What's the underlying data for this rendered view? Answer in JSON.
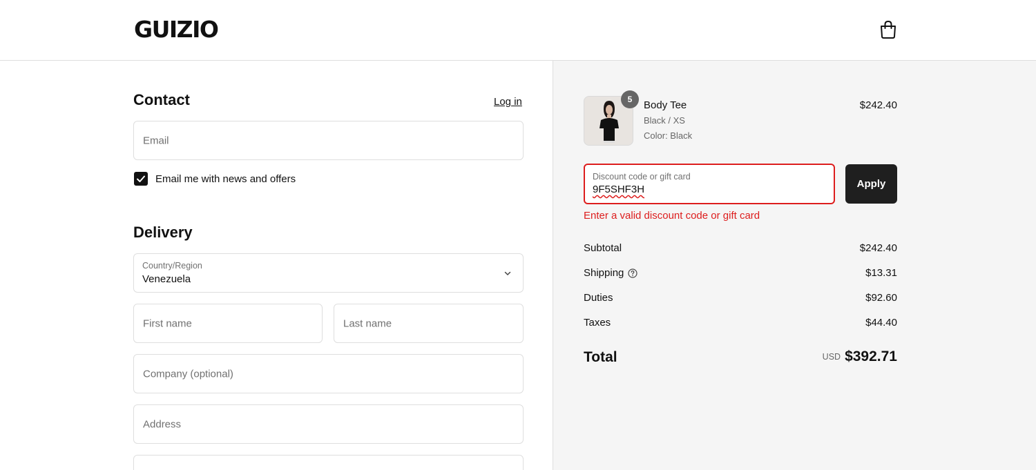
{
  "brand": {
    "logo_text": "GUIZIO"
  },
  "contact": {
    "heading": "Contact",
    "login_link": "Log in",
    "email_placeholder": "Email",
    "newsletter_label": "Email me with news and offers",
    "newsletter_checked": true
  },
  "delivery": {
    "heading": "Delivery",
    "country_label": "Country/Region",
    "country_value": "Venezuela",
    "first_name_placeholder": "First name",
    "last_name_placeholder": "Last name",
    "company_placeholder": "Company (optional)",
    "address_placeholder": "Address"
  },
  "order": {
    "item": {
      "name": "Body Tee",
      "variant": "Black / XS",
      "color": "Color: Black",
      "price": "$242.40",
      "quantity": "5"
    },
    "discount": {
      "label": "Discount code or gift card",
      "value": "9F5SHF3H",
      "apply_label": "Apply",
      "error": "Enter a valid discount code or gift card"
    },
    "summary": {
      "subtotal_label": "Subtotal",
      "subtotal_value": "$242.40",
      "shipping_label": "Shipping",
      "shipping_value": "$13.31",
      "duties_label": "Duties",
      "duties_value": "$92.60",
      "taxes_label": "Taxes",
      "taxes_value": "$44.40",
      "total_label": "Total",
      "currency": "USD",
      "total_value": "$392.71"
    }
  },
  "colors": {
    "accent_dark": "#1f1f1f",
    "error": "#dd1d1d",
    "summary_bg": "#f5f5f5"
  },
  "icons": {
    "cart": "shopping-bag-icon",
    "check": "check-icon",
    "chevron": "chevron-down-icon",
    "help": "question-circle-icon"
  }
}
